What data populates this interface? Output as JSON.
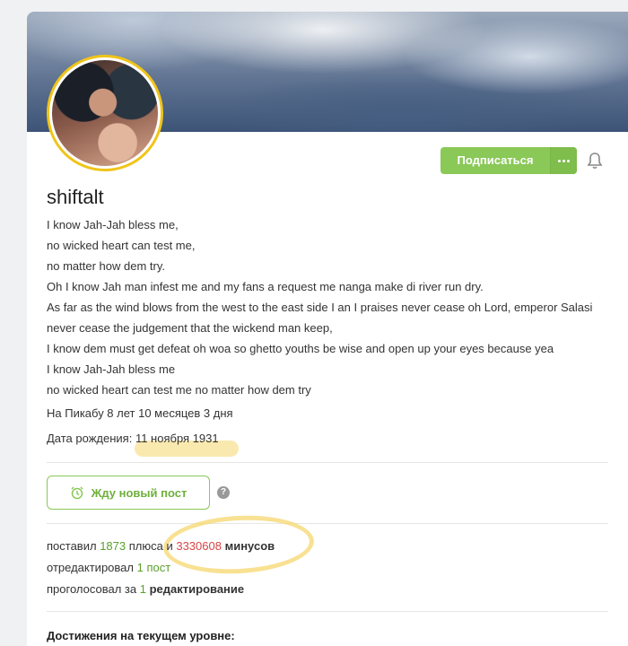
{
  "profile": {
    "username": "shiftalt",
    "subscribe_label": "Подписаться",
    "bio_lines": [
      "I know Jah-Jah bless me,",
      "no wicked heart can test me,",
      "no matter how dem try.",
      "Oh I know Jah man infest me and my fans a request me nanga make di river run dry.",
      "As far as the wind blows from the west to the east side I an I praises never cease oh Lord, emperor Salasi",
      "never cease the judgement that the wickend man keep,",
      "I know dem must get defeat oh woa so ghetto youths be wise and open up your eyes because yea",
      "I know Jah-Jah bless me",
      "no wicked heart can test me no matter how dem try"
    ],
    "on_site": "На Пикабу 8 лет 10 месяцев 3 дня",
    "birthday_label": "Дата рождения:",
    "birthday_value": "11 ноября 1931",
    "wait_post_label": "Жду новый пост",
    "help_glyph": "?"
  },
  "stats": {
    "line1_prefix": "поставил",
    "plus_count": "1873",
    "plus_word": "плюса и",
    "minus_count": "3330608",
    "minus_word": "минусов",
    "line2_prefix": "отредактировал",
    "edit_count": "1",
    "edit_word": "пост",
    "line3_prefix": "проголосовал за",
    "vote_count": "1",
    "vote_word": "редактирование"
  },
  "achievements_title": "Достижения на текущем уровне:",
  "colors": {
    "accent_green": "#8ac858",
    "minus_red": "#d64545",
    "avatar_ring": "#f0c419",
    "marker_yellow": "#f5d76e"
  },
  "icons": {
    "more": "dots-icon",
    "bell": "bell-icon",
    "alarm": "alarm-clock-icon",
    "help": "question-icon"
  }
}
